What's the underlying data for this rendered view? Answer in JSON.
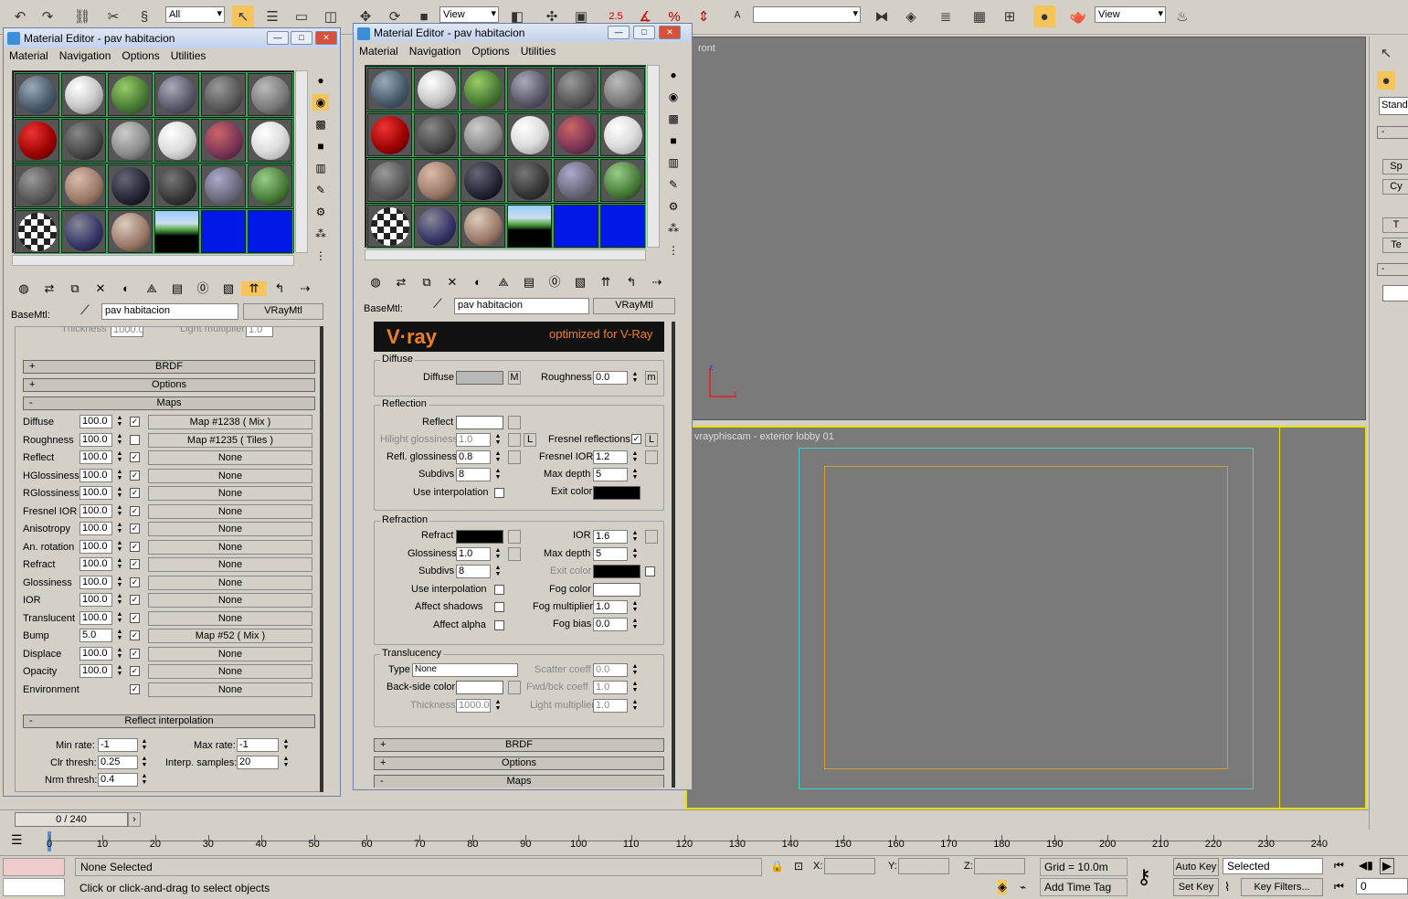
{
  "toolbar": {
    "filter_value": "All",
    "refcoord_value": "View",
    "refcoord2_value": "View",
    "spinner_snap_label": "2.5",
    "named_sel_value": ""
  },
  "viewports": {
    "front_label": "ront",
    "camera_label": "vrayphiscam - exterior lobby 01",
    "colors": {
      "bg": "#7a7a7a",
      "highlight": "#e8e000",
      "safe_frame_outer": "#3fd0d0",
      "safe_frame_inner": "#d0a030"
    }
  },
  "right_panel": {
    "dropdown_value": "Stand",
    "items": [
      "Sp",
      "Cy",
      "T",
      "Te"
    ]
  },
  "editor_left": {
    "title": "Material Editor - pav habitacion",
    "menu": [
      "Material",
      "Navigation",
      "Options",
      "Utilities"
    ],
    "basemtl_label": "BaseMtl:",
    "material_name": "pav habitacion",
    "material_type": "VRayMtl",
    "ghost_row": {
      "thickness_label": "Thickness",
      "thickness_value": "1000.0",
      "light_mult_label": "Light multiplier",
      "light_mult_value": "1.0"
    },
    "rollouts": {
      "brdf": "BRDF",
      "options": "Options",
      "maps": "Maps",
      "reflect_interp": "Reflect interpolation"
    },
    "maps": [
      {
        "label": "Diffuse",
        "value": "100.0",
        "checked": true,
        "map": "Map #1238  ( Mix )"
      },
      {
        "label": "Roughness",
        "value": "100.0",
        "checked": false,
        "map": "Map #1235  ( Tiles )"
      },
      {
        "label": "Reflect",
        "value": "100.0",
        "checked": true,
        "map": "None"
      },
      {
        "label": "HGlossiness",
        "value": "100.0",
        "checked": true,
        "map": "None"
      },
      {
        "label": "RGlossiness",
        "value": "100.0",
        "checked": true,
        "map": "None"
      },
      {
        "label": "Fresnel IOR",
        "value": "100.0",
        "checked": true,
        "map": "None"
      },
      {
        "label": "Anisotropy",
        "value": "100.0",
        "checked": true,
        "map": "None"
      },
      {
        "label": "An. rotation",
        "value": "100.0",
        "checked": true,
        "map": "None"
      },
      {
        "label": "Refract",
        "value": "100.0",
        "checked": true,
        "map": "None"
      },
      {
        "label": "Glossiness",
        "value": "100.0",
        "checked": true,
        "map": "None"
      },
      {
        "label": "IOR",
        "value": "100.0",
        "checked": true,
        "map": "None"
      },
      {
        "label": "Translucent",
        "value": "100.0",
        "checked": true,
        "map": "None"
      },
      {
        "label": "Bump",
        "value": "5.0",
        "checked": true,
        "map": "Map #52  ( Mix )"
      },
      {
        "label": "Displace",
        "value": "100.0",
        "checked": true,
        "map": "None"
      },
      {
        "label": "Opacity",
        "value": "100.0",
        "checked": true,
        "map": "None"
      },
      {
        "label": "Environment",
        "value": "",
        "checked": true,
        "map": "None"
      }
    ],
    "interp": {
      "min_rate_label": "Min rate:",
      "min_rate": "-1",
      "max_rate_label": "Max rate:",
      "max_rate": "-1",
      "clr_thresh_label": "Clr thresh:",
      "clr_thresh": "0.25",
      "interp_samples_label": "Interp. samples:",
      "interp_samples": "20",
      "nrm_thresh_label": "Nrm thresh:",
      "nrm_thresh": "0.4"
    }
  },
  "editor_right": {
    "title": "Material Editor - pav habitacion",
    "menu": [
      "Material",
      "Navigation",
      "Options",
      "Utilities"
    ],
    "basemtl_label": "BaseMtl:",
    "material_name": "pav habitacion",
    "material_type": "VRayMtl",
    "vray_logo": "V·ray",
    "vray_tagline": "optimized for V-Ray",
    "diffuse": {
      "group": "Diffuse",
      "diffuse_label": "Diffuse",
      "m_btn": "M",
      "roughness_label": "Roughness",
      "roughness": "0.0",
      "m2_btn": "m"
    },
    "reflection": {
      "group": "Reflection",
      "reflect_label": "Reflect",
      "hilight_label": "Hilight glossiness",
      "hilight": "1.0",
      "l_btn": "L",
      "fresnel_label": "Fresnel reflections",
      "refl_gloss_label": "Refl. glossiness",
      "refl_gloss": "0.8",
      "fresnel_ior_label": "Fresnel IOR",
      "fresnel_ior": "1.2",
      "subdivs_label": "Subdivs",
      "subdivs": "8",
      "max_depth_label": "Max depth",
      "max_depth": "5",
      "use_interp_label": "Use interpolation",
      "exit_color_label": "Exit color"
    },
    "refraction": {
      "group": "Refraction",
      "refract_label": "Refract",
      "ior_label": "IOR",
      "ior": "1.6",
      "gloss_label": "Glossiness",
      "gloss": "1.0",
      "max_depth_label": "Max depth",
      "max_depth": "5",
      "subdivs_label": "Subdivs",
      "subdivs": "8",
      "exit_color_label": "Exit color",
      "use_interp_label": "Use interpolation",
      "fog_color_label": "Fog color",
      "affect_shadows_label": "Affect shadows",
      "fog_mult_label": "Fog multiplier",
      "fog_mult": "1.0",
      "affect_alpha_label": "Affect alpha",
      "fog_bias_label": "Fog bias",
      "fog_bias": "0.0"
    },
    "translucency": {
      "group": "Translucency",
      "type_label": "Type",
      "type_value": "None",
      "scatter_label": "Scatter coeff",
      "scatter": "0.0",
      "backside_label": "Back-side color",
      "fwd_label": "Fwd/bck coeff",
      "fwd": "1.0",
      "thickness_label": "Thickness",
      "thickness": "1000.0",
      "light_mult_label": "Light multiplier",
      "light_mult": "1.0"
    },
    "rollouts": {
      "brdf": "BRDF",
      "options": "Options",
      "maps": "Maps"
    }
  },
  "timeline": {
    "slider_label": "0 / 240",
    "ticks": [
      "0",
      "10",
      "20",
      "30",
      "40",
      "50",
      "60",
      "70",
      "80",
      "90",
      "100",
      "110",
      "120",
      "130",
      "140",
      "150",
      "160",
      "170",
      "180",
      "190",
      "200",
      "210",
      "220",
      "230",
      "240"
    ]
  },
  "status": {
    "selection": "None Selected",
    "prompt": "Click or click-and-drag to select objects",
    "x_label": "X:",
    "y_label": "Y:",
    "z_label": "Z:",
    "grid": "Grid = 10.0m",
    "add_time_tag": "Add Time Tag",
    "auto_key": "Auto Key",
    "set_key": "Set Key",
    "key_mode_value": "Selected",
    "key_filters": "Key Filters...",
    "frame_value": "0"
  }
}
